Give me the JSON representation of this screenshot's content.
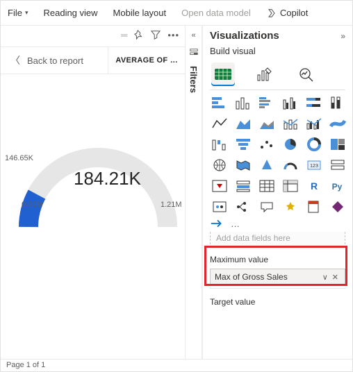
{
  "topbar": {
    "file": "File",
    "reading": "Reading view",
    "mobile": "Mobile layout",
    "datamodel": "Open data model",
    "copilot": "Copilot"
  },
  "canvas": {
    "back": "Back to report",
    "title": "AVERAGE OF …"
  },
  "chart_data": {
    "type": "gauge",
    "value_label": "184.21K",
    "min_label": "0.00M",
    "max_label": "1.21M",
    "pointer_label": "146.65K",
    "value": 184210,
    "min": 0,
    "max": 1210000,
    "fill_to": 146650
  },
  "filters": {
    "label": "Filters"
  },
  "viz": {
    "title": "Visualizations",
    "build": "Build visual",
    "more": "…",
    "add_placeholder": "Add data fields here",
    "max_label": "Maximum value",
    "max_field": "Max of Gross Sales",
    "target_label": "Target value"
  },
  "status": {
    "page": "Page 1 of 1"
  }
}
